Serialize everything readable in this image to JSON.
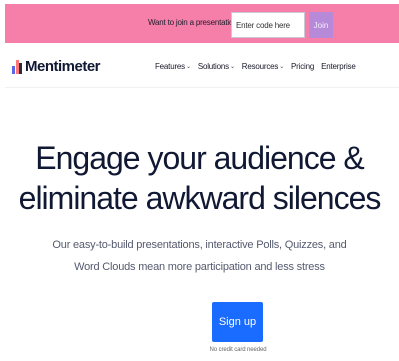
{
  "topbar": {
    "prompt": "Want to join a presentation?",
    "code_placeholder": "Enter code here",
    "join_label": "Join"
  },
  "brand": {
    "name": "Mentimeter"
  },
  "nav": {
    "features": "Features",
    "solutions": "Solutions",
    "resources": "Resources",
    "pricing": "Pricing",
    "enterprise": "Enterprise"
  },
  "hero": {
    "title_line1": "Engage your audience &",
    "title_line2": "eliminate awkward silences",
    "sub_line1": "Our easy-to-build presentations, interactive Polls, Quizzes, and",
    "sub_line2": "Word Clouds mean more participation and less stress",
    "signup_label": "Sign up",
    "note": "No credit card needed"
  },
  "colors": {
    "topbar_bg": "#f57fa8",
    "join_bg": "#b789d9",
    "primary": "#196cff",
    "text_dark": "#101834"
  }
}
